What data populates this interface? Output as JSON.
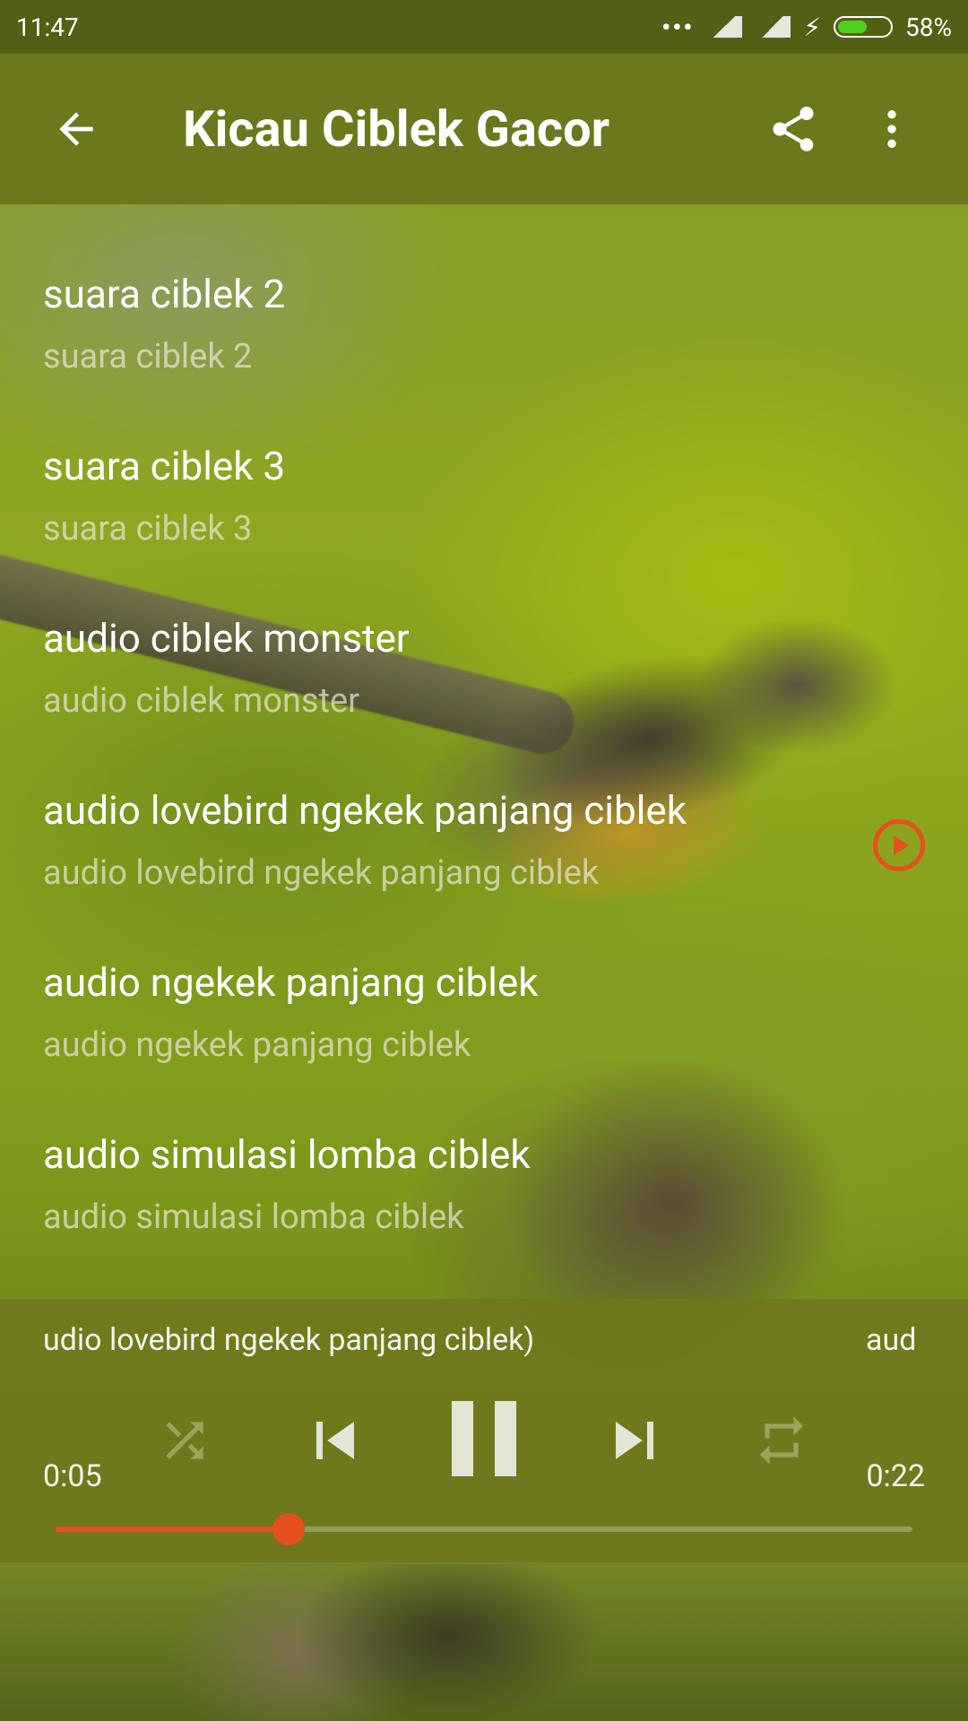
{
  "status_bar": {
    "time": "11:47",
    "battery_percent": "58%",
    "battery_level": 0.58
  },
  "app_bar": {
    "title": "Kicau Ciblek Gacor"
  },
  "list": {
    "items": [
      {
        "title": "suara ciblek 2",
        "subtitle": "suara ciblek 2",
        "playing": false
      },
      {
        "title": "suara ciblek 3",
        "subtitle": "suara ciblek 3",
        "playing": false
      },
      {
        "title": "audio ciblek monster",
        "subtitle": "audio ciblek monster",
        "playing": false
      },
      {
        "title": "audio lovebird ngekek panjang ciblek",
        "subtitle": "audio lovebird ngekek panjang ciblek",
        "playing": true
      },
      {
        "title": "audio ngekek panjang ciblek",
        "subtitle": "audio ngekek panjang ciblek",
        "playing": false
      },
      {
        "title": "audio simulasi lomba ciblek",
        "subtitle": "audio simulasi lomba ciblek",
        "playing": false
      }
    ]
  },
  "player": {
    "marquee_text": "udio lovebird ngekek panjang ciblek)",
    "marquee_next": "aud",
    "elapsed": "0:05",
    "duration": "0:22",
    "progress": 0.272,
    "accent_color": "#e5501e"
  },
  "colors": {
    "status_bar": "#535f15",
    "app_bar": "#6c781b",
    "accent": "#e5501e"
  },
  "icons": {
    "back": "arrow-left-icon",
    "share": "share-icon",
    "more": "more-vert-icon",
    "play": "play-circle-icon",
    "shuffle": "shuffle-icon",
    "previous": "skip-previous-icon",
    "pause": "pause-icon",
    "next": "skip-next-icon",
    "repeat": "repeat-icon"
  }
}
